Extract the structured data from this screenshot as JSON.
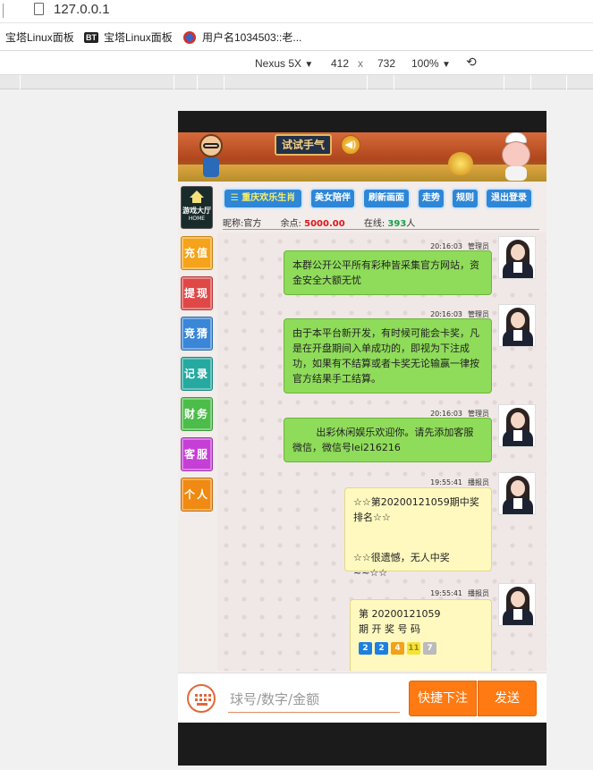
{
  "browser": {
    "url": "127.0.0.1",
    "bookmarks": [
      {
        "label": "宝塔Linux面板",
        "icon": "panel-icon"
      },
      {
        "label": "宝塔Linux面板",
        "icon": "bt-icon",
        "badge": "BT"
      },
      {
        "label": "用户名1034503::老...",
        "icon": "user-badge-icon"
      }
    ],
    "device": {
      "name": "Nexus 5X",
      "dropdown_glyph": "▼",
      "width": "412",
      "times": "x",
      "height": "732",
      "zoom": "100%",
      "rotate_glyph": "⟲"
    }
  },
  "banner": {
    "logo_text": "试试手气",
    "sound_glyph": "◀)"
  },
  "sidebar": {
    "home": {
      "line1": "游戏大厅",
      "line2": "HOME"
    },
    "items": [
      {
        "label": "充值",
        "color": "#f5a31a"
      },
      {
        "label": "提现",
        "color": "#e04848"
      },
      {
        "label": "竞猜",
        "color": "#3a86d8"
      },
      {
        "label": "记录",
        "color": "#26a9a0"
      },
      {
        "label": "财务",
        "color": "#4cbd4a"
      },
      {
        "label": "客服",
        "color": "#c53fd6"
      },
      {
        "label": "个人",
        "color": "#f08a12"
      }
    ]
  },
  "nav": {
    "game_button": "☰ 重庆欢乐生肖",
    "buttons": [
      "美女陪伴",
      "刷新画面",
      "走势",
      "规则",
      "退出登录"
    ]
  },
  "info": {
    "nickname_label": "昵称:",
    "nickname": "官方",
    "balance_label": "余点:",
    "balance": "5000.00",
    "online_label": "在线:",
    "online_count": "393",
    "online_unit": "人"
  },
  "messages": [
    {
      "time": "20:16:03",
      "sender": "管理员",
      "text": "本群公开公平所有彩种皆采集官方网站，资金安全大额无忧",
      "style": "green"
    },
    {
      "time": "20:16:03",
      "sender": "管理员",
      "text": "由于本平台新开发，有时候可能会卡奖，凡是在开盘期间入单成功的，即视为下注成功，如果有不结算或者卡奖无论输赢一律按官方结果手工结算。",
      "style": "green"
    },
    {
      "time": "20:16:03",
      "sender": "管理员",
      "text": "出彩休闲娱乐欢迎你。请先添加客服微信，微信号lei216216",
      "style": "green"
    },
    {
      "time": "19:55:41",
      "sender": "播报员",
      "line1": "☆☆第20200121059期中奖排名☆☆",
      "line2": "☆☆很遗憾，无人中奖~~☆☆",
      "style": "yellow"
    },
    {
      "time": "19:55:41",
      "sender": "播报员",
      "line1": "第 20200121059",
      "line2": "期 开 奖 号 码",
      "style": "yellow",
      "balls": [
        {
          "n": "2",
          "color": "#1e7fe0"
        },
        {
          "n": "2",
          "color": "#1e7fe0"
        },
        {
          "n": "4",
          "color": "#f2a11a"
        },
        {
          "n": "11",
          "color": "#f5e33a"
        },
        {
          "n": "7",
          "color": "#bbbbbb"
        }
      ]
    }
  ],
  "input": {
    "placeholder": "球号/数字/金额",
    "quick_bet": "快捷下注",
    "send": "发送"
  }
}
